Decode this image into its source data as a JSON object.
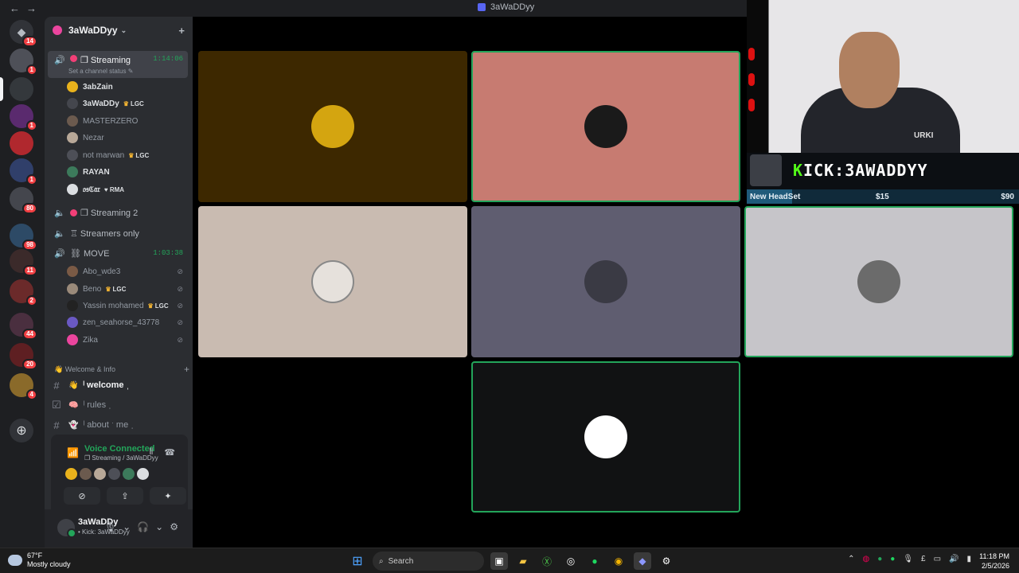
{
  "window": {
    "title": "3aWaDDyy",
    "back_icon": "←",
    "forward_icon": "→"
  },
  "servers": [
    {
      "badge": "14"
    },
    {
      "badge": "1"
    },
    {
      "badge": ""
    },
    {
      "badge": "1"
    },
    {
      "badge": ""
    },
    {
      "badge": "1"
    },
    {
      "badge": "80"
    },
    {
      "badge": "98"
    },
    {
      "badge": "11"
    },
    {
      "badge": "2"
    },
    {
      "badge": "44"
    },
    {
      "badge": "20"
    },
    {
      "badge": "4"
    }
  ],
  "guild": {
    "name": "3aWaDDyy",
    "chevron": "⌄",
    "invite_icon": "+"
  },
  "channels": {
    "streaming": {
      "label": "❐ Streaming",
      "timer": "1:14:06",
      "status": "Set a channel status ✎"
    },
    "streaming_members": [
      {
        "name": "3abZain",
        "tag": "",
        "avatar_color": "#e9b21c"
      },
      {
        "name": "3aWaDDy",
        "tag": "LGC",
        "avatar_color": "#2f3136"
      },
      {
        "name": "MASTERZERO",
        "tag": "",
        "avatar_color": "#6b5a4e"
      },
      {
        "name": "Nezar",
        "tag": "",
        "avatar_color": "#b8a898"
      },
      {
        "name": "not marwan",
        "tag": "LGC",
        "avatar_color": "#4d4f57"
      },
      {
        "name": "RAYAN",
        "tag": "",
        "avatar_color": "#3c7a5b"
      },
      {
        "name": "𝔬𝔰ℭ𝔞𝔯",
        "tag": "♥ RMA",
        "avatar_color": "#2b2d31"
      }
    ],
    "streaming2": {
      "label": "❐ Streaming 2"
    },
    "streamers_only": {
      "label": "♖ Streamers only"
    },
    "move": {
      "label": "⛓ MOVE",
      "timer": "1:03:38"
    },
    "move_members": [
      {
        "name": "Abo_wde3",
        "tag": "",
        "avatar_color": "#7a5a45"
      },
      {
        "name": "Beno",
        "tag": "LGC",
        "avatar_color": "#9a8a7a"
      },
      {
        "name": "Yassin mohamed",
        "tag": "LGC",
        "avatar_color": "#222"
      },
      {
        "name": "zen_seahorse_43778",
        "tag": "",
        "avatar_color": "#6a59c4"
      },
      {
        "name": "Zika",
        "tag": "",
        "avatar_color": "#eb459e"
      }
    ],
    "category": "👋 Welcome & Info",
    "text_channels": [
      {
        "emoji": "👋",
        "label": "ˡ welcome ˌ",
        "unread": true
      },
      {
        "emoji": "🧠",
        "label": "ˡ rules ˌ",
        "unread": false
      },
      {
        "emoji": "👻",
        "label": "ˡ about ˑ me ˌ",
        "unread": false
      }
    ]
  },
  "voice_panel": {
    "title": "Voice Connected",
    "subtitle": "❐ Streaming / 3aWaDDyy",
    "avatars": [
      "#e9b21c",
      "#6b5a4e",
      "#b8a898",
      "#4d4f57",
      "#3c7a5b",
      "#2b2d31"
    ],
    "buttons": [
      "⊘",
      "⇪",
      "✦",
      "✺"
    ]
  },
  "user": {
    "name": "3aWaDDy",
    "status": "• Kick: 3aWaDDyy",
    "controls": [
      "🎙",
      "⌄",
      "🎧",
      "⌄",
      "⚙"
    ]
  },
  "tiles": [
    {
      "bg": "#3d2800",
      "avatar": "#d4a510",
      "speaking": false
    },
    {
      "bg": "#c77b71",
      "avatar": "#1a1a1a",
      "speaking": true
    },
    {
      "bg": "#c9bbb1",
      "avatar": "#e6e1dc",
      "speaking": false
    },
    {
      "bg": "#5f5d70",
      "avatar": "#3a3a44",
      "speaking": false
    },
    {
      "bg": "#c6c5c9",
      "avatar": "#6b6b6b",
      "speaking": true
    },
    {
      "bg": "#111213",
      "avatar": "#ffffff",
      "speaking": true
    }
  ],
  "overlay": {
    "kick_prefix": "K",
    "kick_rest": "ICK:3AWADDYY",
    "hoodie_text": "URKI",
    "goal_label": "New HeadSet",
    "goal_current": "$15",
    "goal_target": "$90",
    "goal_fraction": 0.167
  },
  "taskbar": {
    "temp": "67°F",
    "weather": "Mostly cloudy",
    "search_placeholder": "Search",
    "time": "11:18 PM",
    "date": "2/5/2026",
    "tray_lang": "£"
  },
  "colors": {
    "accent_green": "#23a55a",
    "discord_blurple": "#5865f2",
    "kick_green": "#53fc18",
    "badge_red": "#f23f43"
  }
}
